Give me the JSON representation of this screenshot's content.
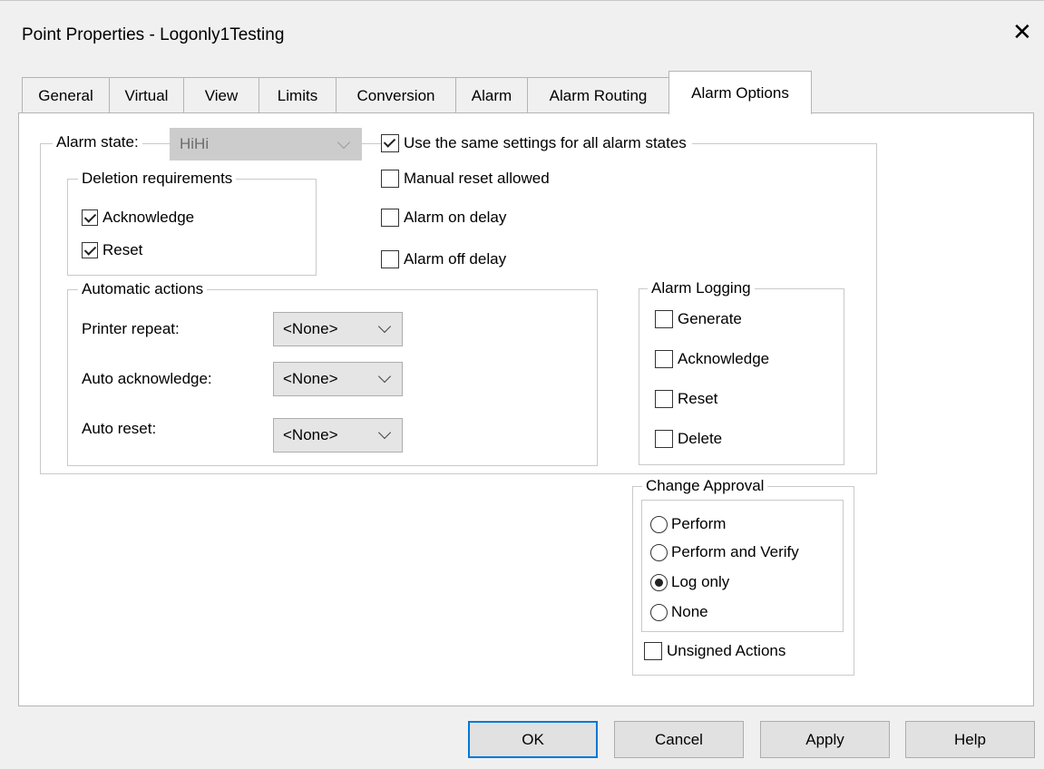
{
  "window": {
    "title": "Point Properties - Logonly1Testing"
  },
  "tabs": [
    {
      "label": "General"
    },
    {
      "label": "Virtual"
    },
    {
      "label": "View"
    },
    {
      "label": "Limits"
    },
    {
      "label": "Conversion"
    },
    {
      "label": "Alarm"
    },
    {
      "label": "Alarm Routing"
    },
    {
      "label": "Alarm Options",
      "active": true
    }
  ],
  "alarm_state": {
    "label": "Alarm state:",
    "value": "HiHi",
    "enabled": false
  },
  "same_settings": {
    "label": "Use the same settings for all alarm states",
    "checked": true
  },
  "deletion": {
    "title": "Deletion requirements",
    "acknowledge": {
      "label": "Acknowledge",
      "checked": true
    },
    "reset": {
      "label": "Reset",
      "checked": true
    }
  },
  "options": {
    "manual_reset": {
      "label": "Manual reset allowed",
      "checked": false
    },
    "alarm_on_delay": {
      "label": "Alarm on delay",
      "checked": false
    },
    "alarm_off_delay": {
      "label": "Alarm off delay",
      "checked": false
    }
  },
  "automatic_actions": {
    "title": "Automatic actions",
    "printer_repeat": {
      "label": "Printer repeat:",
      "value": "<None>"
    },
    "auto_acknowledge": {
      "label": "Auto acknowledge:",
      "value": "<None>"
    },
    "auto_reset": {
      "label": "Auto reset:",
      "value": "<None>"
    }
  },
  "alarm_logging": {
    "title": "Alarm Logging",
    "generate": {
      "label": "Generate",
      "checked": false
    },
    "acknowledge": {
      "label": "Acknowledge",
      "checked": false
    },
    "reset": {
      "label": "Reset",
      "checked": false
    },
    "delete": {
      "label": "Delete",
      "checked": false
    }
  },
  "change_approval": {
    "title": "Change Approval",
    "options": [
      "Perform",
      "Perform and Verify",
      "Log only",
      "None"
    ],
    "selected": "Log only",
    "unsigned_actions": {
      "label": "Unsigned Actions",
      "checked": false
    }
  },
  "buttons": {
    "ok": "OK",
    "cancel": "Cancel",
    "apply": "Apply",
    "help": "Help"
  },
  "icons": {
    "close": "close-icon",
    "dropdown": "chevron-down-icon"
  }
}
